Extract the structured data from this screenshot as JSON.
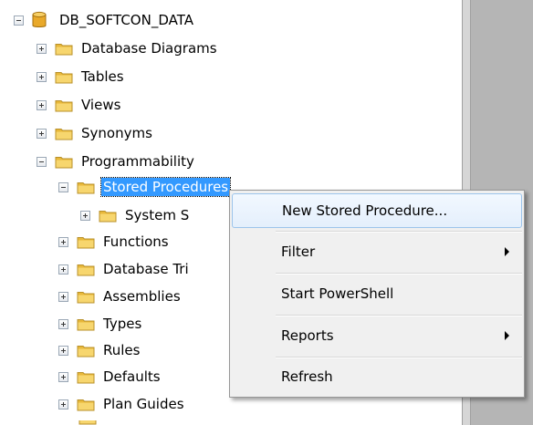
{
  "tree": {
    "root": "DB_SOFTCON_DATA",
    "database_diagrams": "Database Diagrams",
    "tables": "Tables",
    "views": "Views",
    "synonyms": "Synonyms",
    "programmability": "Programmability",
    "stored_procedures": "Stored Procedures",
    "system_stored": "System S",
    "functions": "Functions",
    "database_triggers": "Database Tri",
    "assemblies": "Assemblies",
    "types": "Types",
    "rules": "Rules",
    "defaults": "Defaults",
    "plan_guides": "Plan Guides"
  },
  "context_menu": {
    "new_stored_procedure": "New Stored Procedure...",
    "filter": "Filter",
    "start_powershell": "Start PowerShell",
    "reports": "Reports",
    "refresh": "Refresh"
  },
  "colors": {
    "selection": "#3399ff",
    "folder": "#f0c64f",
    "menu_background": "#f0f0f0",
    "menu_highlight_border": "#9cc4eb"
  },
  "icons": [
    "database-icon",
    "folder-icon",
    "expand-icon",
    "collapse-icon",
    "submenu-arrow-icon"
  ]
}
